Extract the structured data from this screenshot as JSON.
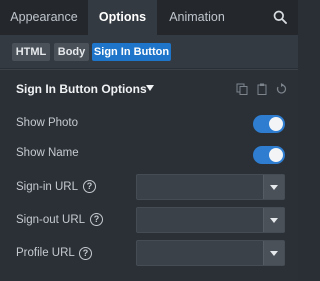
{
  "tabs": [
    {
      "label": "Appearance",
      "active": false
    },
    {
      "label": "Options",
      "active": true
    },
    {
      "label": "Animation",
      "active": false
    }
  ],
  "subtabs": [
    {
      "label": "HTML",
      "active": false
    },
    {
      "label": "Body",
      "active": false
    },
    {
      "label": "Sign In Button",
      "active": true
    }
  ],
  "section": {
    "title": "Sign In Button Options",
    "tools": [
      "copy-icon",
      "paste-icon",
      "reset-icon"
    ]
  },
  "fields": {
    "show_photo": {
      "label": "Show Photo",
      "enabled": true
    },
    "show_name": {
      "label": "Show Name",
      "enabled": true
    },
    "signin_url": {
      "label": "Sign-in URL",
      "help": "?",
      "value": ""
    },
    "signout_url": {
      "label": "Sign-out URL",
      "help": "?",
      "value": ""
    },
    "profile_url": {
      "label": "Profile URL",
      "help": "?",
      "value": ""
    }
  },
  "colors": {
    "accent": "#1f75c9",
    "toggle_on": "#2e7dd1",
    "panel_bg": "#2b3036",
    "tab_bar_bg": "#24282d"
  }
}
